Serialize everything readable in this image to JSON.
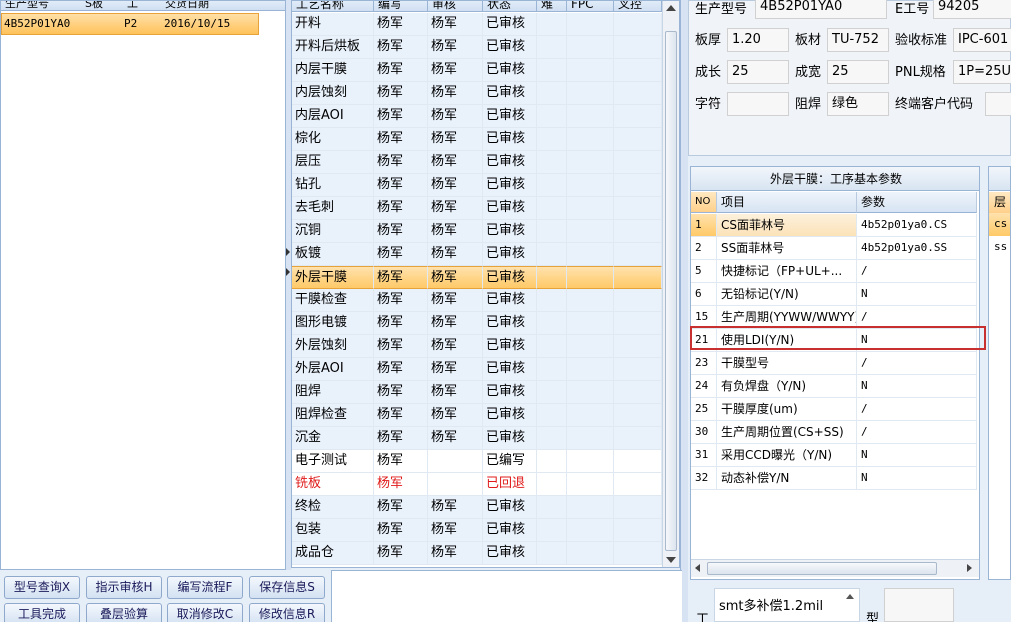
{
  "left_list": {
    "headers": [
      "生产型号",
      "S板",
      "工",
      "交货日期"
    ],
    "row": {
      "model": "4B52P01YA0",
      "grade": "P2",
      "date": "2016/10/15"
    }
  },
  "process_grid": {
    "headers": [
      "工艺名称",
      "编写",
      "审核",
      "状态",
      "难",
      "FPC",
      "叉控"
    ],
    "rows": [
      {
        "name": "开料",
        "writer": "杨军",
        "reviewer": "杨军",
        "status": "已审核"
      },
      {
        "name": "开料后烘板",
        "writer": "杨军",
        "reviewer": "杨军",
        "status": "已审核"
      },
      {
        "name": "内层干膜",
        "writer": "杨军",
        "reviewer": "杨军",
        "status": "已审核"
      },
      {
        "name": "内层蚀刻",
        "writer": "杨军",
        "reviewer": "杨军",
        "status": "已审核"
      },
      {
        "name": "内层AOI",
        "writer": "杨军",
        "reviewer": "杨军",
        "status": "已审核"
      },
      {
        "name": "棕化",
        "writer": "杨军",
        "reviewer": "杨军",
        "status": "已审核"
      },
      {
        "name": "层压",
        "writer": "杨军",
        "reviewer": "杨军",
        "status": "已审核"
      },
      {
        "name": "钻孔",
        "writer": "杨军",
        "reviewer": "杨军",
        "status": "已审核"
      },
      {
        "name": "去毛刺",
        "writer": "杨军",
        "reviewer": "杨军",
        "status": "已审核"
      },
      {
        "name": "沉铜",
        "writer": "杨军",
        "reviewer": "杨军",
        "status": "已审核"
      },
      {
        "name": "板镀",
        "writer": "杨军",
        "reviewer": "杨军",
        "status": "已审核"
      },
      {
        "name": "外层干膜",
        "writer": "杨军",
        "reviewer": "杨军",
        "status": "已审核"
      },
      {
        "name": "干膜检查",
        "writer": "杨军",
        "reviewer": "杨军",
        "status": "已审核"
      },
      {
        "name": "图形电镀",
        "writer": "杨军",
        "reviewer": "杨军",
        "status": "已审核"
      },
      {
        "name": "外层蚀刻",
        "writer": "杨军",
        "reviewer": "杨军",
        "status": "已审核"
      },
      {
        "name": "外层AOI",
        "writer": "杨军",
        "reviewer": "杨军",
        "status": "已审核"
      },
      {
        "name": "阻焊",
        "writer": "杨军",
        "reviewer": "杨军",
        "status": "已审核"
      },
      {
        "name": "阻焊检查",
        "writer": "杨军",
        "reviewer": "杨军",
        "status": "已审核"
      },
      {
        "name": "沉金",
        "writer": "杨军",
        "reviewer": "杨军",
        "status": "已审核"
      },
      {
        "name": "电子测试",
        "writer": "杨军",
        "reviewer": "",
        "status": "已编写"
      },
      {
        "name": "铣板",
        "writer": "杨军",
        "reviewer": "",
        "status": "已回退"
      },
      {
        "name": "终检",
        "writer": "杨军",
        "reviewer": "杨军",
        "status": "已审核"
      },
      {
        "name": "包装",
        "writer": "杨军",
        "reviewer": "杨军",
        "status": "已审核"
      },
      {
        "name": "成品仓",
        "writer": "杨军",
        "reviewer": "杨军",
        "status": "已审核"
      }
    ]
  },
  "buttons": {
    "model_query": "型号查询X",
    "guide_review": "指示审核H",
    "edit_flow": "编写流程F",
    "save_info": "保存信息S",
    "tool_done": "工具完成",
    "stack_check": "叠层验算",
    "cancel_edit": "取消修改C",
    "modify_info": "修改信息R"
  },
  "info": {
    "model_label": "生产型号",
    "model_value": "4B52P01YA0",
    "eng_label": "E工号",
    "eng_value": "94205",
    "thickness_label": "板厚",
    "thickness_value": "1.20",
    "material_label": "板材",
    "material_value": "TU-752",
    "standard_label": "验收标准",
    "standard_value": "IPC-601",
    "length_label": "成长",
    "length_value": "25",
    "width_label": "成宽",
    "width_value": "25",
    "pnl_label": "PNL规格",
    "pnl_value": "1P=25U",
    "char_label": "字符",
    "char_value": "",
    "mask_label": "阻焊",
    "mask_value": "绿色",
    "customer_label": "终端客户代码",
    "customer_value": ""
  },
  "params": {
    "title": "外层干膜：工序基本参数",
    "headers": [
      "NO",
      "项目",
      "参数"
    ],
    "rows": [
      {
        "no": "1",
        "item": "CS面菲林号",
        "value": "4b52p01ya0.CS"
      },
      {
        "no": "2",
        "item": "SS面菲林号",
        "value": "4b52p01ya0.SS"
      },
      {
        "no": "5",
        "item": "快捷标记（FP+UL+...",
        "value": "/"
      },
      {
        "no": "6",
        "item": "无铅标记(Y/N)",
        "value": "N"
      },
      {
        "no": "15",
        "item": "生产周期(YYWW/WWYY)",
        "value": "/"
      },
      {
        "no": "21",
        "item": "使用LDI(Y/N)",
        "value": "N"
      },
      {
        "no": "23",
        "item": "干膜型号",
        "value": "/"
      },
      {
        "no": "24",
        "item": "有负焊盘（Y/N)",
        "value": "N"
      },
      {
        "no": "25",
        "item": "干膜厚度(um)",
        "value": "/"
      },
      {
        "no": "30",
        "item": "生产周期位置(CS+SS)",
        "value": "/"
      },
      {
        "no": "31",
        "item": "采用CCD曝光（Y/N)",
        "value": "N"
      },
      {
        "no": "32",
        "item": "动态补偿Y/N",
        "value": "N"
      }
    ]
  },
  "right_panel": {
    "header": "层",
    "row1": "cs",
    "row2": "ss"
  },
  "bottom_right": {
    "label_left": "工",
    "note": "smt多补偿1.2mil",
    "label_right": "型"
  }
}
